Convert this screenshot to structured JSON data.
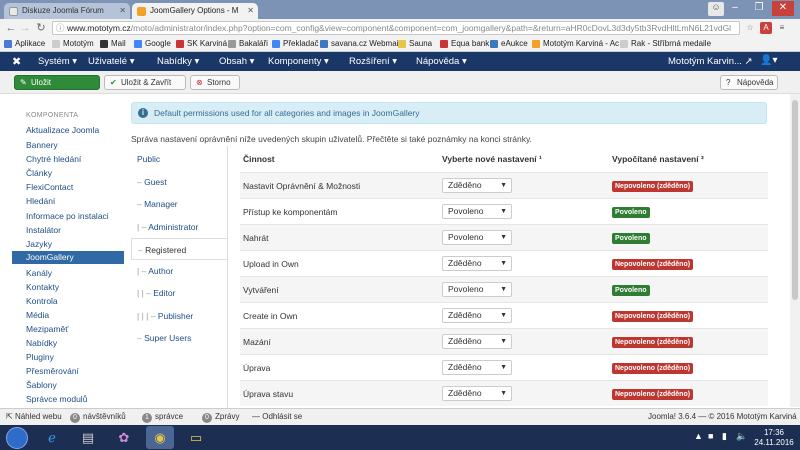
{
  "browser": {
    "tabs": [
      {
        "label": "Diskuze Joomla Fórum",
        "active": false
      },
      {
        "label": "JoomGallery Options - M",
        "active": true
      }
    ],
    "url_host": "www.mototym.cz",
    "url_path": "/moto/administrator/index.php?option=com_config&view=component&component=com_joomgallery&path=&return=aHR0cDovL3d3dy5tb3RvdHltLmN6L21vdGl",
    "bookmarks": [
      "Aplikace",
      "Mototým",
      "Mail",
      "Google",
      "SK Karviná",
      "Bakaláři",
      "Překladač",
      "savana.cz Webmail",
      "Sauna",
      "Equa bank",
      "eAukce",
      "Mototým Karviná - Ac",
      "Rak - Stříbrná medaile"
    ]
  },
  "joomla": {
    "menu": [
      "Systém ▾",
      "Uživatelé ▾",
      "Nabídky ▾",
      "Obsah ▾",
      "Komponenty ▾",
      "Rozšíření ▾",
      "Nápověda ▾"
    ],
    "site_name": "Mototým Karvin... ↗",
    "user_menu": "▾"
  },
  "toolbar": {
    "save": "Uložit",
    "save_close": "Uložit & Zavřít",
    "cancel": "Storno",
    "help": "Nápověda"
  },
  "sidebar": {
    "heading": "KOMPONENTA",
    "items": [
      "Aktualizace Joomla",
      "Bannery",
      "Chytré hledání",
      "Články",
      "FlexiContact",
      "Hledání",
      "Informace po instalaci",
      "Instalátor",
      "Jazyky",
      "JoomGallery",
      "Kanály",
      "Kontakty",
      "Kontrola",
      "Média",
      "Mezipaměť",
      "Nabídky",
      "Pluginy",
      "Přesměrování",
      "Šablony",
      "Správce modulů"
    ],
    "active_index": 9
  },
  "alert": "Default permissions used for all categories and images in JoomGallery",
  "intro": "Správa nastavení oprávnění níže uvedených skupin uživatelů. Přečtěte si také poznámky na konci stránky.",
  "groups": [
    {
      "prefix": "",
      "label": "Public"
    },
    {
      "prefix": "– ",
      "label": "Guest"
    },
    {
      "prefix": "– ",
      "label": "Manager"
    },
    {
      "prefix": "|  – ",
      "label": "Administrator"
    },
    {
      "prefix": "– ",
      "label": "Registered"
    },
    {
      "prefix": "|  – ",
      "label": "Author"
    },
    {
      "prefix": "|  |  – ",
      "label": "Editor"
    },
    {
      "prefix": "|  |  |  – ",
      "label": "Publisher"
    },
    {
      "prefix": "– ",
      "label": "Super Users"
    }
  ],
  "selected_group_index": 4,
  "table": {
    "headers": [
      "Činnost",
      "Vyberte nové nastavení ¹",
      "Vypočítané nastavení ²"
    ],
    "rows": [
      {
        "action": "Nastavit Oprávnění & Možnosti",
        "select": "Zděděno",
        "calc": "Nepovoleno (zděděno)",
        "status": "deny"
      },
      {
        "action": "Přístup ke komponentám",
        "select": "Povoleno",
        "calc": "Povoleno",
        "status": "allow"
      },
      {
        "action": "Nahrát",
        "select": "Povoleno",
        "calc": "Povoleno",
        "status": "allow"
      },
      {
        "action": "Upload in Own",
        "select": "Zděděno",
        "calc": "Nepovoleno (zděděno)",
        "status": "deny"
      },
      {
        "action": "Vytváření",
        "select": "Povoleno",
        "calc": "Povoleno",
        "status": "allow"
      },
      {
        "action": "Create in Own",
        "select": "Zděděno",
        "calc": "Nepovoleno (zděděno)",
        "status": "deny"
      },
      {
        "action": "Mazání",
        "select": "Zděděno",
        "calc": "Nepovoleno (zděděno)",
        "status": "deny"
      },
      {
        "action": "Úprava",
        "select": "Zděděno",
        "calc": "Nepovoleno (zděděno)",
        "status": "deny"
      },
      {
        "action": "Úprava stavu",
        "select": "Zděděno",
        "calc": "Nepovoleno (zděděno)",
        "status": "deny"
      }
    ]
  },
  "statusbar": {
    "view_site": "Náhled webu",
    "visitors_count": "0",
    "visitors": "návštěvníků",
    "admins_count": "1",
    "admins": "správce",
    "messages_count": "0",
    "messages": "Zprávy",
    "logout": "Odhlásit se",
    "version": "Joomla! 3.6.4 — © 2016 Mototým Karviná"
  },
  "taskbar": {
    "time": "17:36",
    "date": "24.11.2016"
  },
  "colors": {
    "navbar": "#1a3867",
    "save_button": "#2f8a3a",
    "deny_badge": "#bd362f",
    "allow_badge": "#2e7d32",
    "sidebar_active": "#2f6aa4"
  }
}
